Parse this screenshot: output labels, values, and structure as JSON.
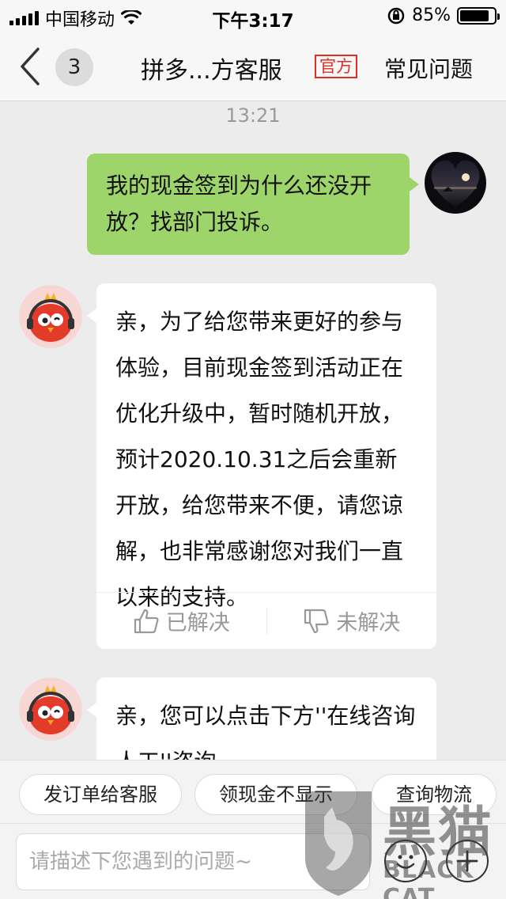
{
  "status_bar": {
    "carrier": "中国移动",
    "time": "下午3:17",
    "battery_percent_text": "85%",
    "battery_level": 0.85
  },
  "nav": {
    "unread_count": "3",
    "title": "拼多...方客服",
    "official_badge": "官方",
    "faq_label": "常见问题"
  },
  "chat": {
    "timestamp": "13:21",
    "messages": [
      {
        "from": "user",
        "text": "我的现金签到为什么还没开放？找部门投诉。"
      },
      {
        "from": "agent",
        "text": "亲，为了给您带来更好的参与体验，目前现金签到活动正在优化升级中，暂时随机开放，预计2020.10.31之后会重新开放，给您带来不便，请您谅解，也非常感谢您对我们一直以来的支持。",
        "feedback": {
          "resolved_label": "已解决",
          "unresolved_label": "未解决"
        }
      },
      {
        "from": "agent",
        "text": "亲，您可以点击下方''在线咨询人工''咨询~"
      }
    ]
  },
  "quick_replies": [
    "发订单给客服",
    "领现金不显示",
    "查询物流"
  ],
  "input": {
    "placeholder": "请描述下您遇到的问题~"
  },
  "watermark": {
    "cn": "黑猫",
    "en": "BLACK CAT"
  },
  "colors": {
    "outgoing_bubble": "#9ed56b",
    "official_red": "#e02e24",
    "background": "#ececec"
  },
  "icons": [
    "signal-icon",
    "wifi-icon",
    "rotation-lock-icon",
    "battery-icon",
    "back-chevron-icon",
    "thumbs-up-icon",
    "thumbs-down-icon",
    "emoji-icon",
    "plus-icon"
  ]
}
